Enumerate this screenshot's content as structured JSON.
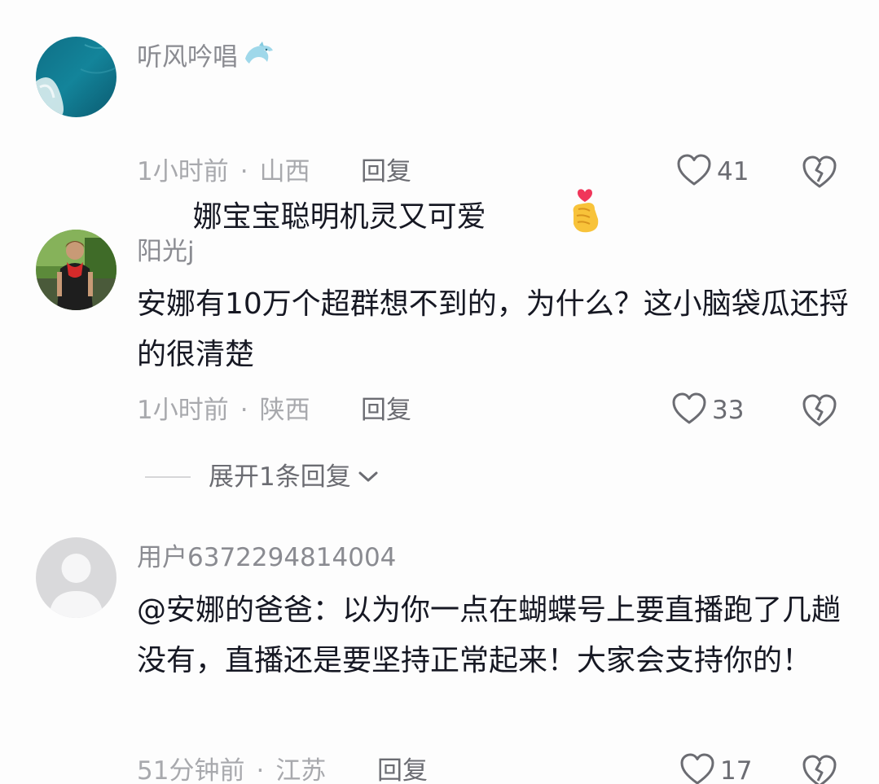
{
  "comments": [
    {
      "username": "听风吟唱",
      "username_icon": "dolphin-icon",
      "text": "娜宝宝聪明机灵又可爱",
      "text_emoji": "finger-heart-emoji",
      "time": "1小时前",
      "location": "山西",
      "reply_label": "回复",
      "likes": "41"
    },
    {
      "username": "阳光j",
      "text": "安娜有10万个超群想不到的，为什么？这小脑袋瓜还捋的很清楚",
      "time": "1小时前",
      "location": "陕西",
      "reply_label": "回复",
      "likes": "33",
      "expand_label": "展开1条回复"
    },
    {
      "username": "用户6372294814004",
      "text": "@安娜的爸爸：以为你一点在蝴蝶号上要直播跑了几趟没有，直播还是要坚持正常起来！大家会支持你的！",
      "time": "51分钟前",
      "location": "江苏",
      "reply_label": "回复",
      "likes": "17"
    }
  ],
  "separator": "·",
  "colors": {
    "text_primary": "#161823",
    "text_secondary": "#8a8b91",
    "meta": "#a8a9ad",
    "icon": "#6b6c72"
  }
}
